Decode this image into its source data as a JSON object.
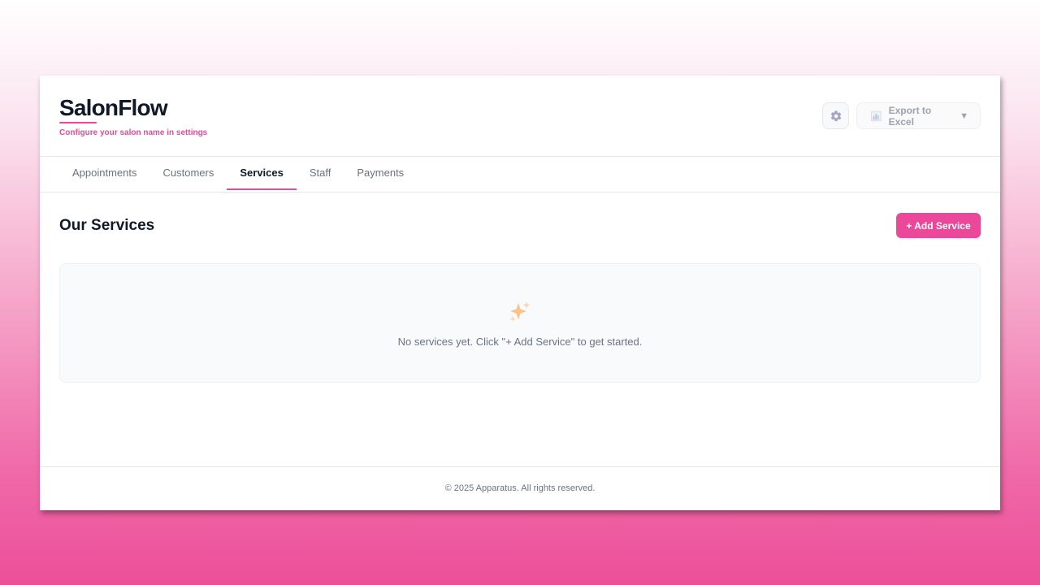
{
  "app": {
    "name": "SalonFlow",
    "subtitle": "Configure your salon name in settings"
  },
  "header": {
    "settings_icon": "gear-icon",
    "export": {
      "label": "Export to Excel",
      "icon": "bar-chart-icon",
      "caret": "▼"
    }
  },
  "tabs": [
    {
      "label": "Appointments",
      "active": false
    },
    {
      "label": "Customers",
      "active": false
    },
    {
      "label": "Services",
      "active": true
    },
    {
      "label": "Staff",
      "active": false
    },
    {
      "label": "Payments",
      "active": false
    }
  ],
  "main": {
    "title": "Our Services",
    "add_button": "+ Add Service",
    "empty_icon": "sparkles-icon",
    "empty_text": "No services yet. Click \"+ Add Service\" to get started."
  },
  "footer": {
    "text": "© 2025 Apparatus. All rights reserved."
  },
  "colors": {
    "accent": "#ec4899",
    "text_dark": "#111827",
    "text_muted": "#6b7280"
  }
}
